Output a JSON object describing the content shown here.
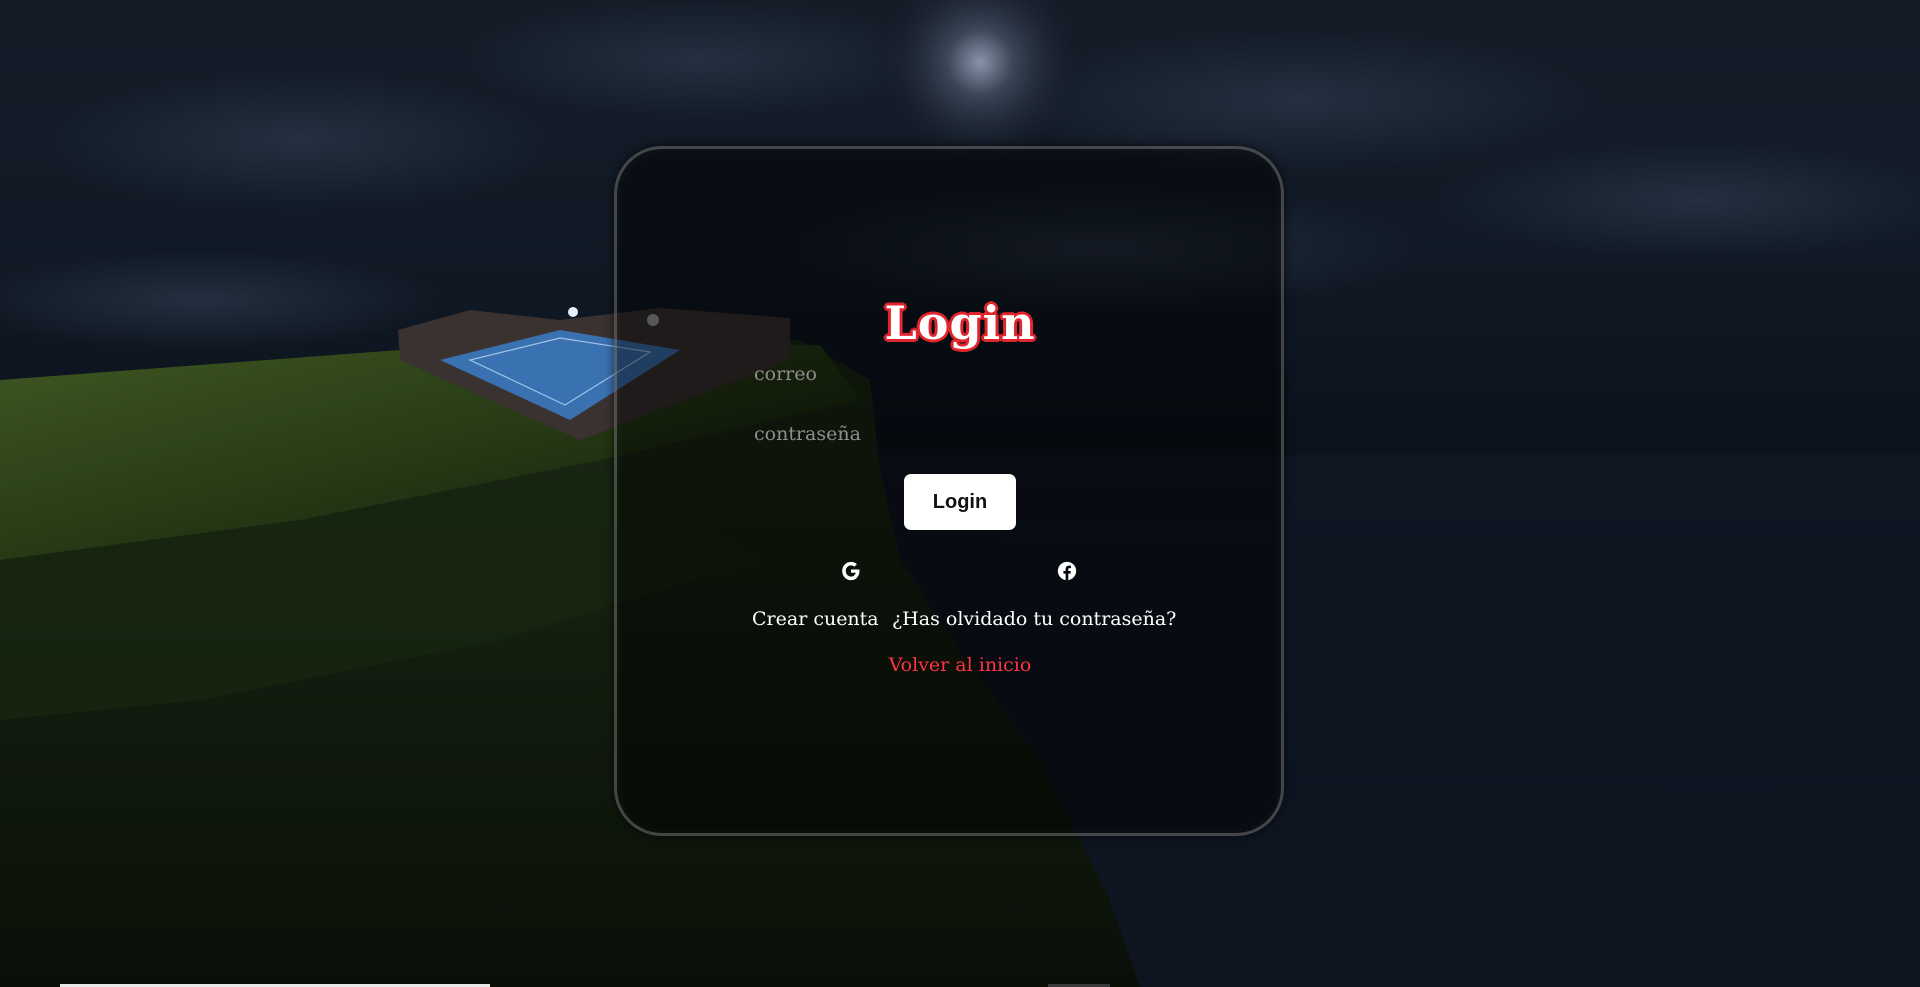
{
  "login": {
    "title": "Login",
    "email_placeholder": "correo",
    "password_placeholder": "contraseña",
    "submit_label": "Login"
  },
  "social": {
    "google_icon": "google-icon",
    "facebook_icon": "facebook-icon"
  },
  "links": {
    "create_account": "Crear cuenta",
    "forgot_password": "¿Has olvidado tu contraseña?",
    "back_home": "Volver al inicio"
  },
  "colors": {
    "title_outline": "#e0262d",
    "back_link": "#ff3340",
    "button_bg": "#ffffff"
  }
}
